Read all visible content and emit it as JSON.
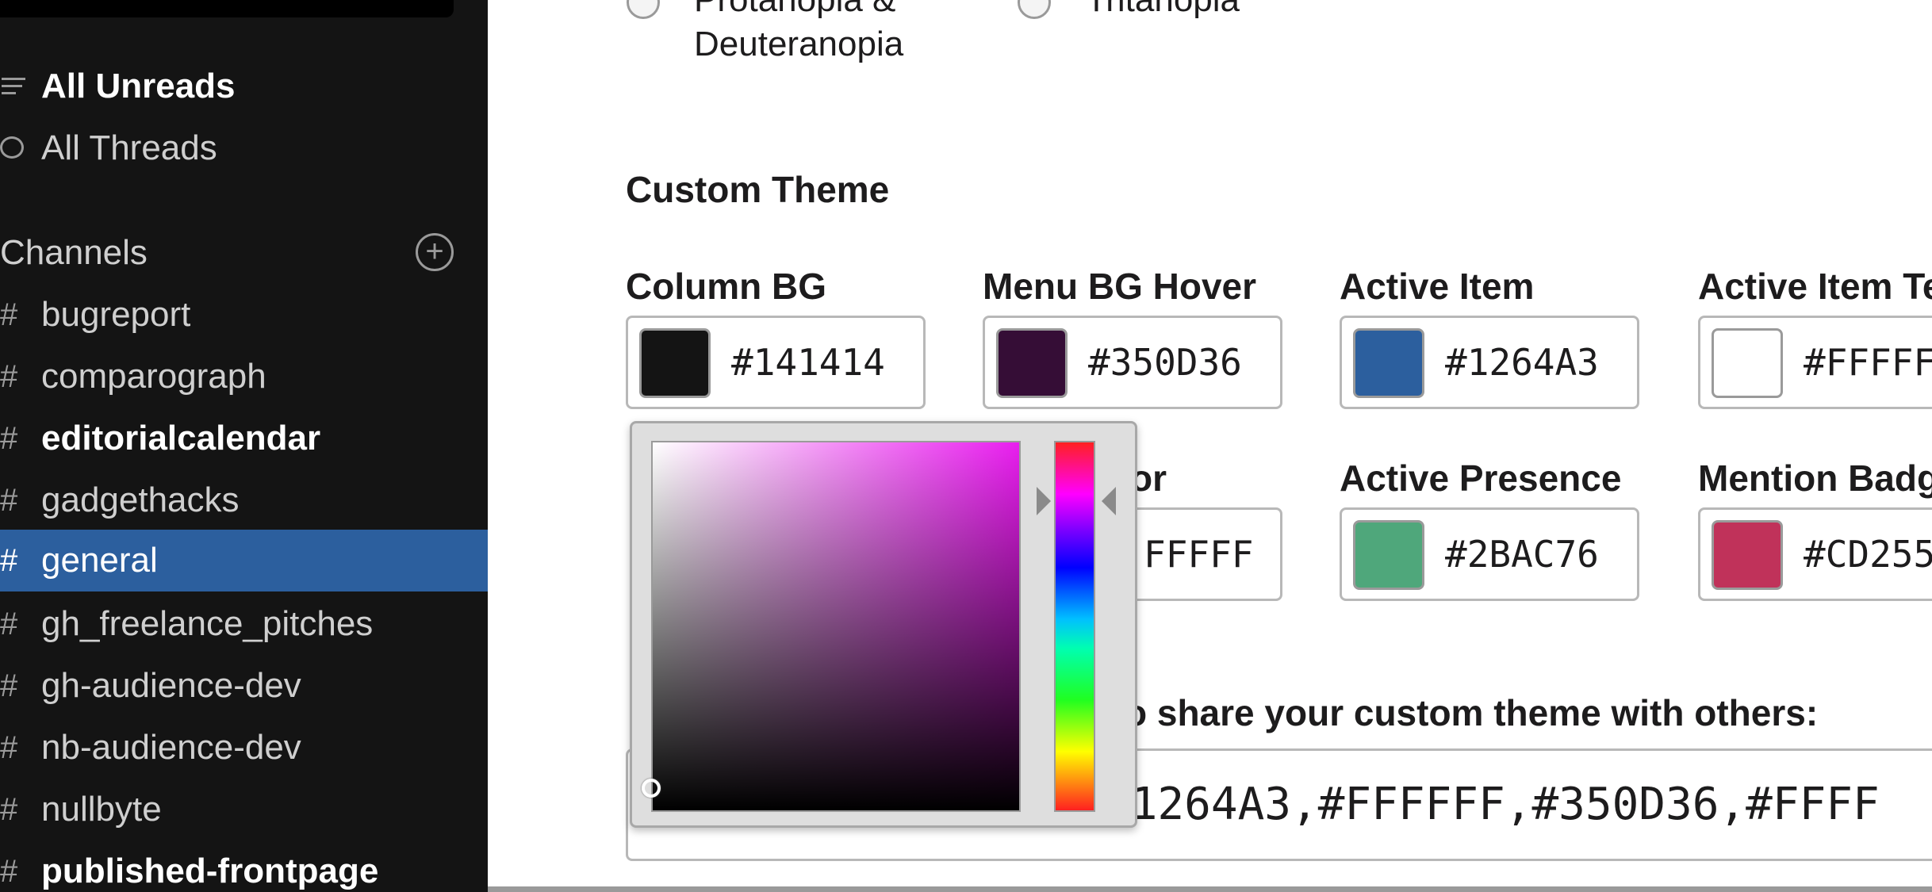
{
  "sidebar": {
    "top": [
      {
        "label": "All Unreads",
        "icon": "all-unreads-icon",
        "bold": true
      },
      {
        "label": "All Threads",
        "icon": "threads-icon",
        "bold": false
      }
    ],
    "channels_heading": "Channels",
    "add_icon": "+",
    "hash": "#",
    "channels": [
      {
        "name": "bugreport",
        "bold": false,
        "active": false
      },
      {
        "name": "comparograph",
        "bold": false,
        "active": false
      },
      {
        "name": "editorialcalendar",
        "bold": true,
        "active": false
      },
      {
        "name": "gadgethacks",
        "bold": false,
        "active": false
      },
      {
        "name": "general",
        "bold": false,
        "active": true
      },
      {
        "name": "gh_freelance_pitches",
        "bold": false,
        "active": false
      },
      {
        "name": "gh-audience-dev",
        "bold": false,
        "active": false
      },
      {
        "name": "nb-audience-dev",
        "bold": false,
        "active": false
      },
      {
        "name": "nullbyte",
        "bold": false,
        "active": false
      },
      {
        "name": "published-frontpage",
        "bold": true,
        "active": false
      }
    ]
  },
  "accessibility": {
    "option_1": {
      "line1": "Protanopia &",
      "line2": "Deuteranopia"
    },
    "option_2": {
      "label": "Tritanopia"
    }
  },
  "custom_theme": {
    "title": "Custom Theme",
    "row1": [
      {
        "label": "Column BG",
        "hex": "#141414",
        "color": "#141414"
      },
      {
        "label": "Menu BG Hover",
        "hex": "#350D36",
        "color": "#350D36"
      },
      {
        "label": "Active Item",
        "hex": "#1264A3",
        "color": "#2C5F9E"
      },
      {
        "label": "Active Item Te",
        "hex": "#FFFFF",
        "color": "#FFFFFF"
      }
    ],
    "row2": [
      {
        "label": "or",
        "hex": "FFFFF",
        "color": "#FFFFFF"
      },
      {
        "label": "Active Presence",
        "hex": "#2BAC76",
        "color": "#4FA77B"
      },
      {
        "label": "Mention Badg",
        "hex": "#CD255",
        "color": "#C0325A"
      }
    ],
    "share_label": "o share your custom theme with others:",
    "share_value": "#1264A3,#FFFFFF,#350D36,#FFFF"
  },
  "picker": {
    "hue_color": "#E91EEF"
  }
}
